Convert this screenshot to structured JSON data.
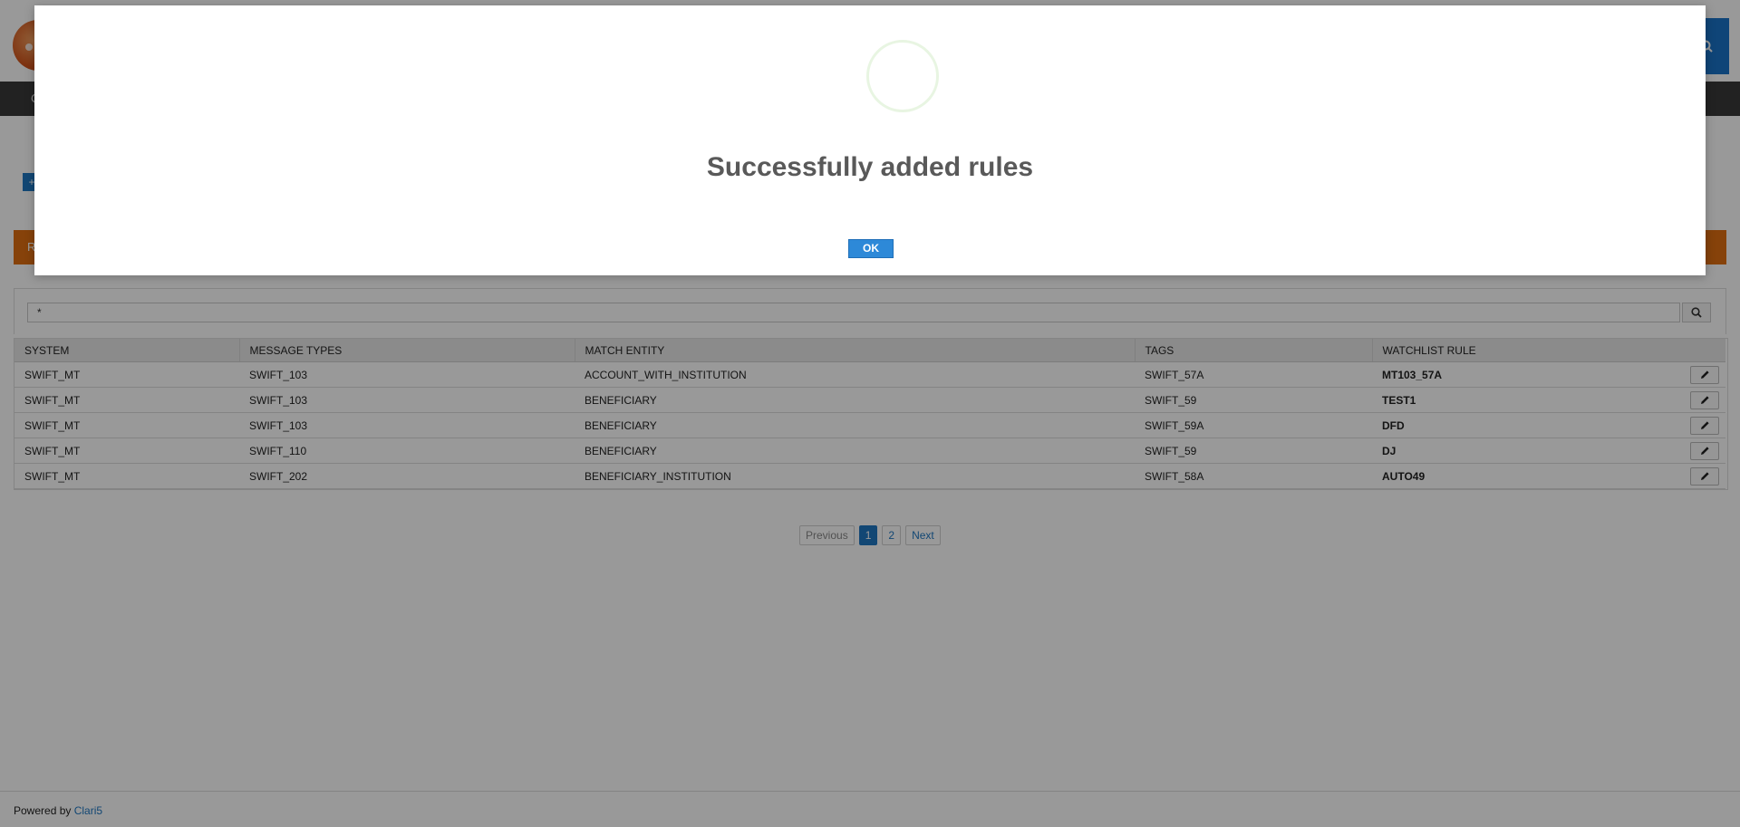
{
  "header": {
    "nav_first": "C",
    "section_bar_initial": "R"
  },
  "search": {
    "value": "*"
  },
  "table": {
    "columns": [
      "SYSTEM",
      "MESSAGE TYPES",
      "MATCH ENTITY",
      "TAGS",
      "WATCHLIST RULE"
    ],
    "rows": [
      {
        "system": "SWIFT_MT",
        "message_type": "SWIFT_103",
        "match_entity": "ACCOUNT_WITH_INSTITUTION",
        "tags": "SWIFT_57A",
        "rule": "MT103_57A"
      },
      {
        "system": "SWIFT_MT",
        "message_type": "SWIFT_103",
        "match_entity": "BENEFICIARY",
        "tags": "SWIFT_59",
        "rule": "TEST1"
      },
      {
        "system": "SWIFT_MT",
        "message_type": "SWIFT_103",
        "match_entity": "BENEFICIARY",
        "tags": "SWIFT_59A",
        "rule": "DFD"
      },
      {
        "system": "SWIFT_MT",
        "message_type": "SWIFT_110",
        "match_entity": "BENEFICIARY",
        "tags": "SWIFT_59",
        "rule": "DJ"
      },
      {
        "system": "SWIFT_MT",
        "message_type": "SWIFT_202",
        "match_entity": "BENEFICIARY_INSTITUTION",
        "tags": "SWIFT_58A",
        "rule": "AUTO49"
      }
    ]
  },
  "pagination": {
    "previous": "Previous",
    "pages": [
      "1",
      "2"
    ],
    "next": "Next",
    "current": "1"
  },
  "footer": {
    "powered_by": "Powered by",
    "brand": "Clari5"
  },
  "modal": {
    "title": "Successfully added rules",
    "ok_label": "OK"
  },
  "colors": {
    "accent": "#1f77c2",
    "section_bar": "#e06e12",
    "navbar": "#3a3a3a"
  }
}
